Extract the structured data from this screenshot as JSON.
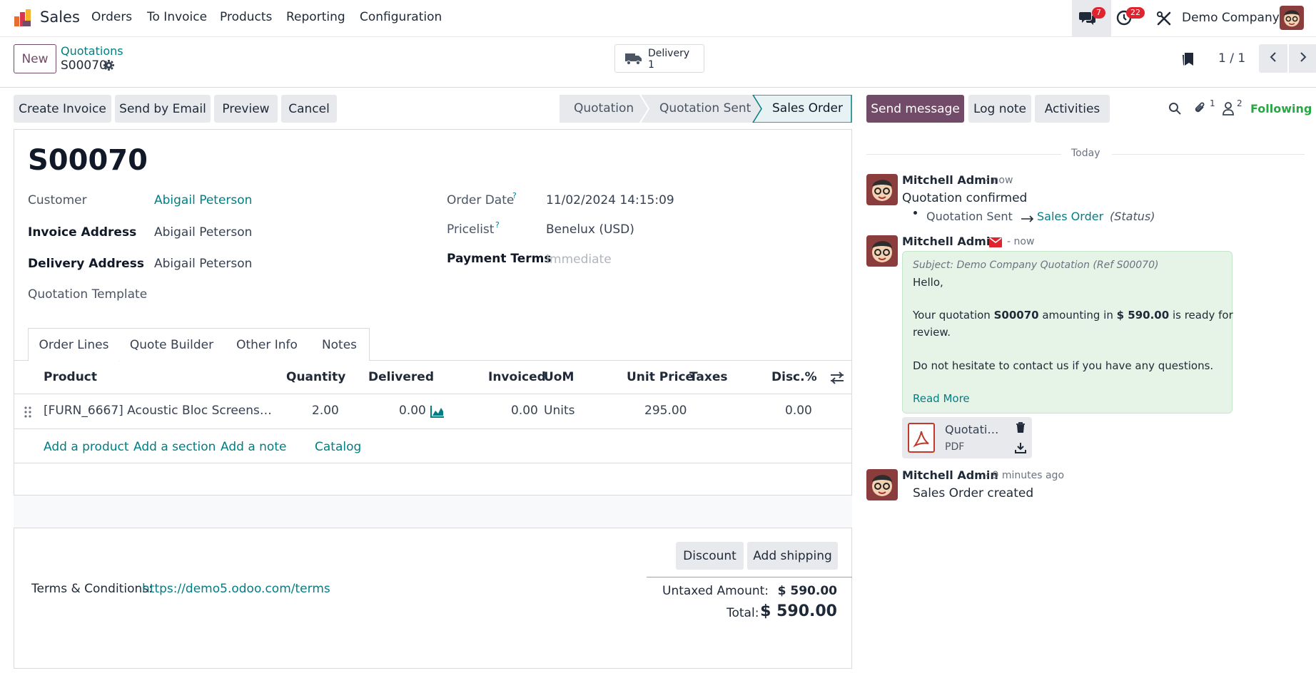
{
  "nav": {
    "app_name": "Sales",
    "menu": [
      "Orders",
      "To Invoice",
      "Products",
      "Reporting",
      "Configuration"
    ],
    "messages_count": "7",
    "activities_count": "22",
    "company": "Demo Company"
  },
  "control": {
    "new_label": "New",
    "breadcrumb_parent": "Quotations",
    "breadcrumb_current": "S00070",
    "delivery_label": "Delivery",
    "delivery_count": "1",
    "pager": "1 / 1"
  },
  "actions": {
    "create_invoice": "Create Invoice",
    "send_email": "Send by Email",
    "preview": "Preview",
    "cancel": "Cancel"
  },
  "status": {
    "steps": [
      "Quotation",
      "Quotation Sent",
      "Sales Order"
    ],
    "active": "Sales Order"
  },
  "form": {
    "title": "S00070",
    "customer_label": "Customer",
    "customer": "Abigail Peterson",
    "invoice_address_label": "Invoice Address",
    "invoice_address": "Abigail Peterson",
    "delivery_address_label": "Delivery Address",
    "delivery_address": "Abigail Peterson",
    "quotation_template_label": "Quotation Template",
    "order_date_label": "Order Date",
    "order_date": "11/02/2024 14:15:09",
    "pricelist_label": "Pricelist",
    "pricelist": "Benelux (USD)",
    "payment_terms_label": "Payment Terms",
    "payment_terms_placeholder": "Immediate",
    "help_mark": "?"
  },
  "tabs": [
    "Order Lines",
    "Quote Builder",
    "Other Info",
    "Notes"
  ],
  "lines": {
    "headers": {
      "product": "Product",
      "quantity": "Quantity",
      "delivered": "Delivered",
      "invoiced": "Invoiced",
      "uom": "UoM",
      "unit_price": "Unit Price",
      "taxes": "Taxes",
      "disc": "Disc.%"
    },
    "rows": [
      {
        "product": "[FURN_6667] Acoustic Bloc Screens…",
        "quantity": "2.00",
        "delivered": "0.00",
        "invoiced": "0.00",
        "uom": "Units",
        "unit_price": "295.00",
        "disc": "0.00"
      }
    ],
    "add_product": "Add a product",
    "add_section": "Add a section",
    "add_note": "Add a note",
    "catalog": "Catalog"
  },
  "footer": {
    "discount": "Discount",
    "add_shipping": "Add shipping",
    "terms_label": "Terms & Conditions:",
    "terms_link": "https://demo5.odoo.com/terms",
    "untaxed_label": "Untaxed Amount:",
    "untaxed_value": "$ 590.00",
    "total_label": "Total:",
    "total_value": "$ 590.00"
  },
  "chatter": {
    "send_message": "Send message",
    "log_note": "Log note",
    "activities": "Activities",
    "attachments_count": "1",
    "followers_count": "2",
    "following": "Following",
    "day": "Today",
    "messages": [
      {
        "author": "Mitchell Admin",
        "time": "- now",
        "body": "Quotation confirmed",
        "tracking_old": "Quotation Sent",
        "tracking_new": "Sales Order",
        "tracking_field": "(Status)"
      },
      {
        "author": "Mitchell Admin",
        "time": "- now",
        "subject": "Subject: Demo Company Quotation (Ref S00070)",
        "hello": "Hello,",
        "line1_a": "Your quotation ",
        "line1_b": "S00070",
        "line1_c": " amounting in ",
        "line1_d": "$ 590.00",
        "line1_e": " is ready for",
        "line2": "review.",
        "line3": "Do not hesitate to contact us if you have any questions.",
        "read_more": "Read More",
        "attachment_name": "Quotati…",
        "attachment_type": "PDF"
      },
      {
        "author": "Mitchell Admin",
        "time": "- 9 minutes ago",
        "body": "Sales Order created"
      }
    ]
  },
  "colors": {
    "brand": "#714b67",
    "teal": "#017e84",
    "following": "#28a745"
  }
}
